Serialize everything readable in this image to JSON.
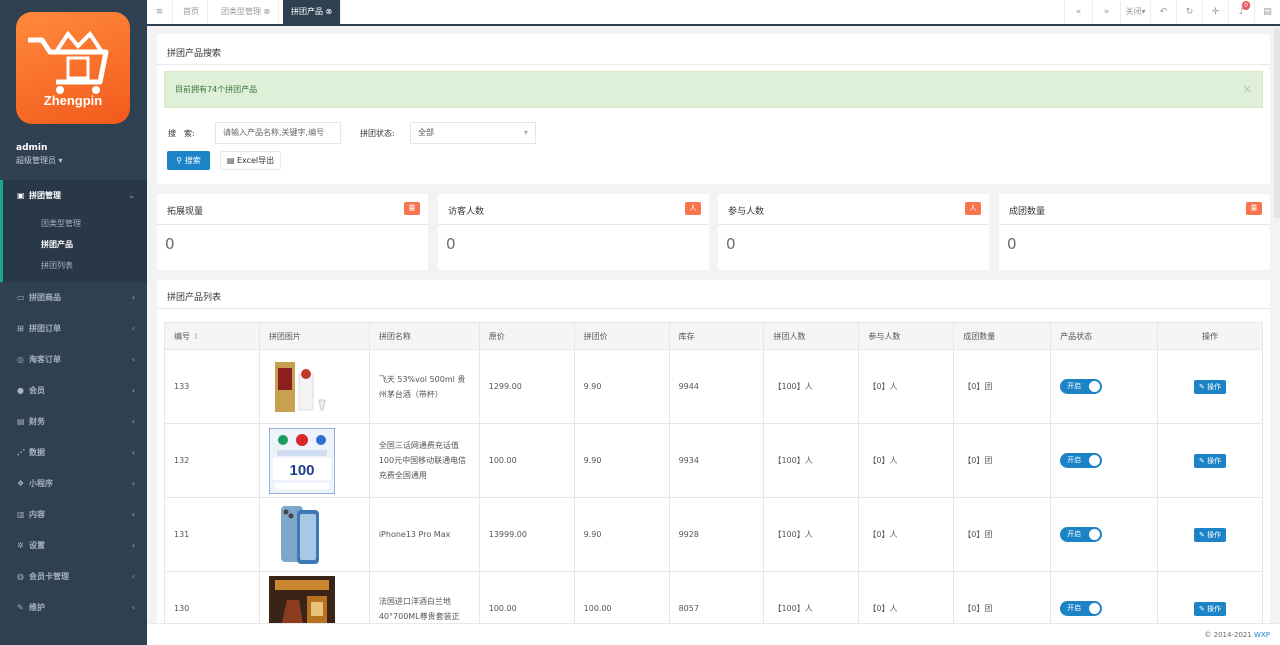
{
  "sidebar": {
    "logo_text": "Zhengpin",
    "user_name": "admin",
    "user_role": "超级管理员",
    "menu": [
      {
        "label": "拼团管理",
        "icon": "gift-icon",
        "active": true
      },
      {
        "label": "拼团商品",
        "icon": "monitor-icon"
      },
      {
        "label": "拼团订单",
        "icon": "cart-icon"
      },
      {
        "label": "淘客订单",
        "icon": "globe-icon"
      },
      {
        "label": "会员",
        "icon": "user-icon"
      },
      {
        "label": "财务",
        "icon": "money-icon"
      },
      {
        "label": "数据",
        "icon": "chart-icon"
      },
      {
        "label": "小程序",
        "icon": "cubes-icon"
      },
      {
        "label": "内容",
        "icon": "book-icon"
      },
      {
        "label": "设置",
        "icon": "gear-icon"
      },
      {
        "label": "会员卡管理",
        "icon": "circle-icon"
      },
      {
        "label": "维护",
        "icon": "wrench-icon"
      }
    ],
    "submenu": [
      "团类型管理",
      "拼团产品",
      "拼团列表"
    ]
  },
  "tabs": {
    "items": [
      "首页",
      "团类型管理",
      "拼团产品"
    ],
    "close_label": "关闭",
    "notif_count": "0"
  },
  "search_panel": {
    "title": "拼团产品搜索",
    "alert": "目前拥有74个拼团产品",
    "search_label": "搜　索:",
    "search_placeholder": "请输入产品名称,关键字,编号",
    "status_label": "拼团状态:",
    "status_value": "全部",
    "search_button": "搜索",
    "export_button": "Excel导出"
  },
  "stats": [
    {
      "title": "拓展现量",
      "tag": "量",
      "value": "0"
    },
    {
      "title": "访客人数",
      "tag": "人",
      "value": "0"
    },
    {
      "title": "参与人数",
      "tag": "人",
      "value": "0"
    },
    {
      "title": "成团数量",
      "tag": "量",
      "value": "0"
    }
  ],
  "table": {
    "title": "拼团产品列表",
    "headers": [
      "编号",
      "拼团图片",
      "拼团名称",
      "原价",
      "拼团价",
      "库存",
      "拼团人数",
      "参与人数",
      "成团数量",
      "产品状态",
      "操作"
    ],
    "rows": [
      {
        "id": "133",
        "name": "飞天 53%vol 500ml 贵州茅台酒（带杯）",
        "price": "1299.00",
        "group_price": "9.90",
        "stock": "9944",
        "group_size": "【100】人",
        "joined": "【0】人",
        "formed": "【0】团",
        "status": "开启",
        "op": "操作"
      },
      {
        "id": "132",
        "name": "全国三话网通费充话值100元中国移动联通电信充费全国通用",
        "price": "100.00",
        "group_price": "9.90",
        "stock": "9934",
        "group_size": "【100】人",
        "joined": "【0】人",
        "formed": "【0】团",
        "status": "开启",
        "op": "操作"
      },
      {
        "id": "131",
        "name": "iPhone13 Pro Max",
        "price": "13999.00",
        "group_price": "9.90",
        "stock": "9928",
        "group_size": "【100】人",
        "joined": "【0】人",
        "formed": "【0】团",
        "status": "开启",
        "op": "操作"
      },
      {
        "id": "130",
        "name": "法国进口洋酒白兰地40°700ML尊贵套装正",
        "price": "100.00",
        "group_price": "100.00",
        "stock": "8057",
        "group_size": "【100】人",
        "joined": "【0】人",
        "formed": "【0】团",
        "status": "开启",
        "op": "操作"
      }
    ]
  },
  "footer": {
    "copyright": "© 2014-2021",
    "brand": "WXP"
  },
  "colors": {
    "sidebar": "#2f4050",
    "primary": "#1c84c6",
    "accent": "#19aa8d",
    "tag": "#f8ac59"
  }
}
